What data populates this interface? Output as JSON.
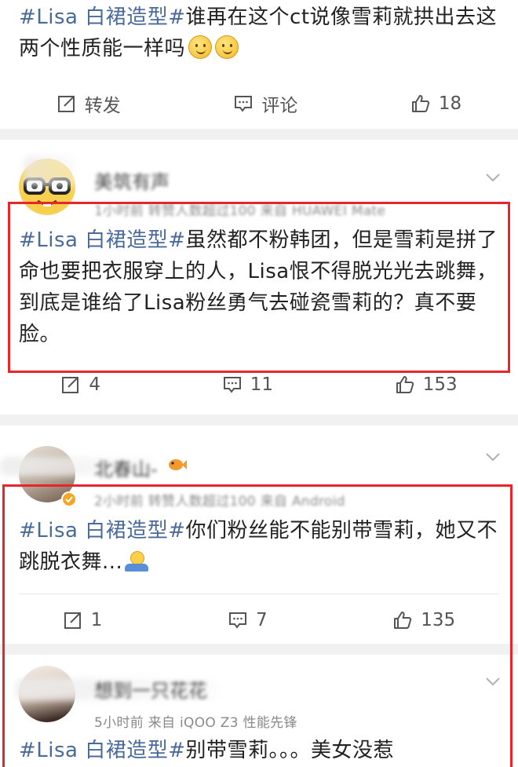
{
  "post1": {
    "tag": "#Lisa 白裙造型#",
    "text": "谁再在这个ct说像雪莉就拱出去这两个性质能一样吗",
    "emojis": [
      "smile-emoji",
      "smile-emoji"
    ],
    "actions": {
      "repost_label": "转发",
      "comment_label": "评论",
      "like_count": "18"
    }
  },
  "post2": {
    "user_name": "美筑有声",
    "meta": "1小时前 转赞人数超过100 来自 HUAWEI Mate",
    "tag": "#Lisa 白裙造型#",
    "text": "虽然都不粉韩团，但是雪莉是拼了命也要把衣服穿上的人，Lisa恨不得脱光光去跳舞，到底是谁给了Lisa粉丝勇气去碰瓷雪莉的？真不要脸。",
    "actions": {
      "repost_count": "4",
      "comment_count": "11",
      "like_count": "153"
    }
  },
  "post3": {
    "user_name": "北春山-",
    "meta": "2小时前 转赞人数超过100 来自 Android",
    "tag": "#Lisa 白裙造型#",
    "text": "你们粉丝能不能别带雪莉，她又不跳脱衣舞...",
    "emoji": "shrug-emoji",
    "actions": {
      "repost_count": "1",
      "comment_count": "7",
      "like_count": "135"
    }
  },
  "post4": {
    "user_name": "想到一只花花",
    "meta": "5小时前  来自 iQOO Z3 性能先锋",
    "tag": "#Lisa 白裙造型#",
    "text": "别带雪莉。。。美女没惹"
  },
  "colors": {
    "tag": "#4a6a9c",
    "highlight_box": "#e8252a",
    "separator": "#f1f1f1"
  }
}
